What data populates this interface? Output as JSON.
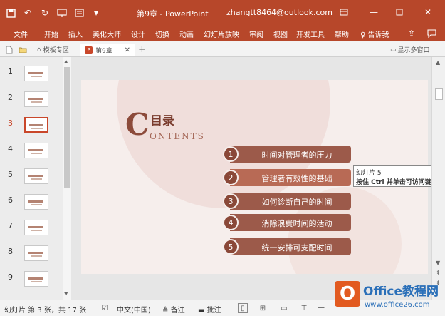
{
  "window": {
    "doc_title": "第9章 - PowerPoint",
    "account": "zhangtt8464@outlook.com"
  },
  "ribbon": {
    "tabs": [
      "文件",
      "开始",
      "插入",
      "美化大师",
      "设计",
      "切换",
      "动画",
      "幻灯片放映",
      "审阅",
      "视图",
      "开发工具",
      "帮助"
    ],
    "tell_me": "告诉我"
  },
  "doc_tabs": {
    "home_tab": "模板专区",
    "active_tab": "第9章",
    "multi_window": "显示多窗口"
  },
  "thumbnails": {
    "numbers": [
      "1",
      "2",
      "3",
      "4",
      "5",
      "6",
      "7",
      "8",
      "9"
    ],
    "selected": "3"
  },
  "slide": {
    "logo_letter": "C",
    "title": "目录",
    "subtitle": "ONTENTS",
    "items": [
      {
        "num": "1",
        "label": "时间对管理者的压力"
      },
      {
        "num": "2",
        "label": "管理者有效性的基础"
      },
      {
        "num": "3",
        "label": "如何诊断自己的时间"
      },
      {
        "num": "4",
        "label": "消除浪费时间的活动"
      },
      {
        "num": "5",
        "label": "统一安排可支配时间"
      }
    ]
  },
  "tooltip": {
    "line1": "幻灯片 5",
    "line2": "按住 Ctrl 并单击可访问链接"
  },
  "status": {
    "slide_info": "幻灯片 第 3 张，共 17 张",
    "language": "中文(中国)",
    "notes": "备注",
    "comments": "批注"
  },
  "watermark": {
    "logo_letter": "O",
    "brand": "Office教程网",
    "url": "www.office26.com"
  },
  "colors": {
    "accent": "#b7472a",
    "menu_bar": "#9c5a4a",
    "slide_bg": "#f6eeec"
  }
}
